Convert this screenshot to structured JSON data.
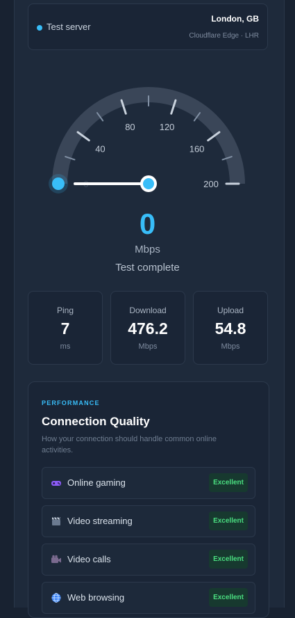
{
  "server": {
    "label": "Test server",
    "city": "London, GB",
    "edge": "Cloudflare Edge · LHR"
  },
  "gauge": {
    "ticks": [
      "0",
      "40",
      "80",
      "120",
      "160",
      "200"
    ],
    "min": 0,
    "max": 200,
    "needle_value": 0,
    "accent": "#38bdf8"
  },
  "speed": {
    "value": "0",
    "unit": "Mbps",
    "status": "Test complete"
  },
  "stats": [
    {
      "label": "Ping",
      "value": "7",
      "unit": "ms"
    },
    {
      "label": "Download",
      "value": "476.2",
      "unit": "Mbps"
    },
    {
      "label": "Upload",
      "value": "54.8",
      "unit": "Mbps"
    }
  ],
  "quality": {
    "eyebrow": "PERFORMANCE",
    "title": "Connection Quality",
    "description": "How your connection should handle common online activities.",
    "rows": [
      {
        "icon": "game-controller-icon",
        "name": "Online gaming",
        "rating": "Excellent"
      },
      {
        "icon": "clapperboard-icon",
        "name": "Video streaming",
        "rating": "Excellent"
      },
      {
        "icon": "video-camera-icon",
        "name": "Video calls",
        "rating": "Excellent"
      },
      {
        "icon": "globe-icon",
        "name": "Web browsing",
        "rating": "Excellent"
      }
    ]
  },
  "colors": {
    "background": "#182231",
    "card": "#1a2536",
    "accent": "#38bdf8",
    "success": "#4ade80"
  }
}
